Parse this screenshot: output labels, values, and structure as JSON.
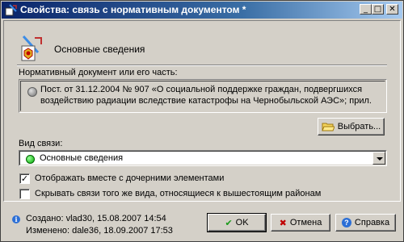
{
  "window": {
    "title": "Свойства: связь с нормативным документом *",
    "minimize_symbol": "_",
    "maximize_symbol": "□",
    "close_symbol": "✕"
  },
  "header": {
    "title": "Основные сведения"
  },
  "document_section": {
    "label": "Нормативный документ или его часть:",
    "value": "Пост. от 31.12.2004 № 907 «О социальной поддержке граждан, подвергшихся воздействию радиации вследствие катастрофы на Чернобыльской АЭС»; прил.",
    "select_button": "Выбрать..."
  },
  "link_type": {
    "label": "Вид связи:",
    "selected": "Основные сведения"
  },
  "checkboxes": [
    {
      "label": "Отображать вместе с дочерними элементами",
      "checked": true
    },
    {
      "label": "Скрывать связи того же вида, относящиеся к вышестоящим районам",
      "checked": false
    }
  ],
  "footer": {
    "created": "Создано: vlad30, 15.08.2007 14:54",
    "modified": "Изменено: dale36, 18.09.2007 17:53",
    "ok_button": "OK",
    "cancel_button": "Отмена",
    "help_button": "Справка"
  },
  "colors": {
    "titlebar_start": "#0a246a",
    "titlebar_end": "#a6caf0",
    "face": "#d4d0c8"
  }
}
